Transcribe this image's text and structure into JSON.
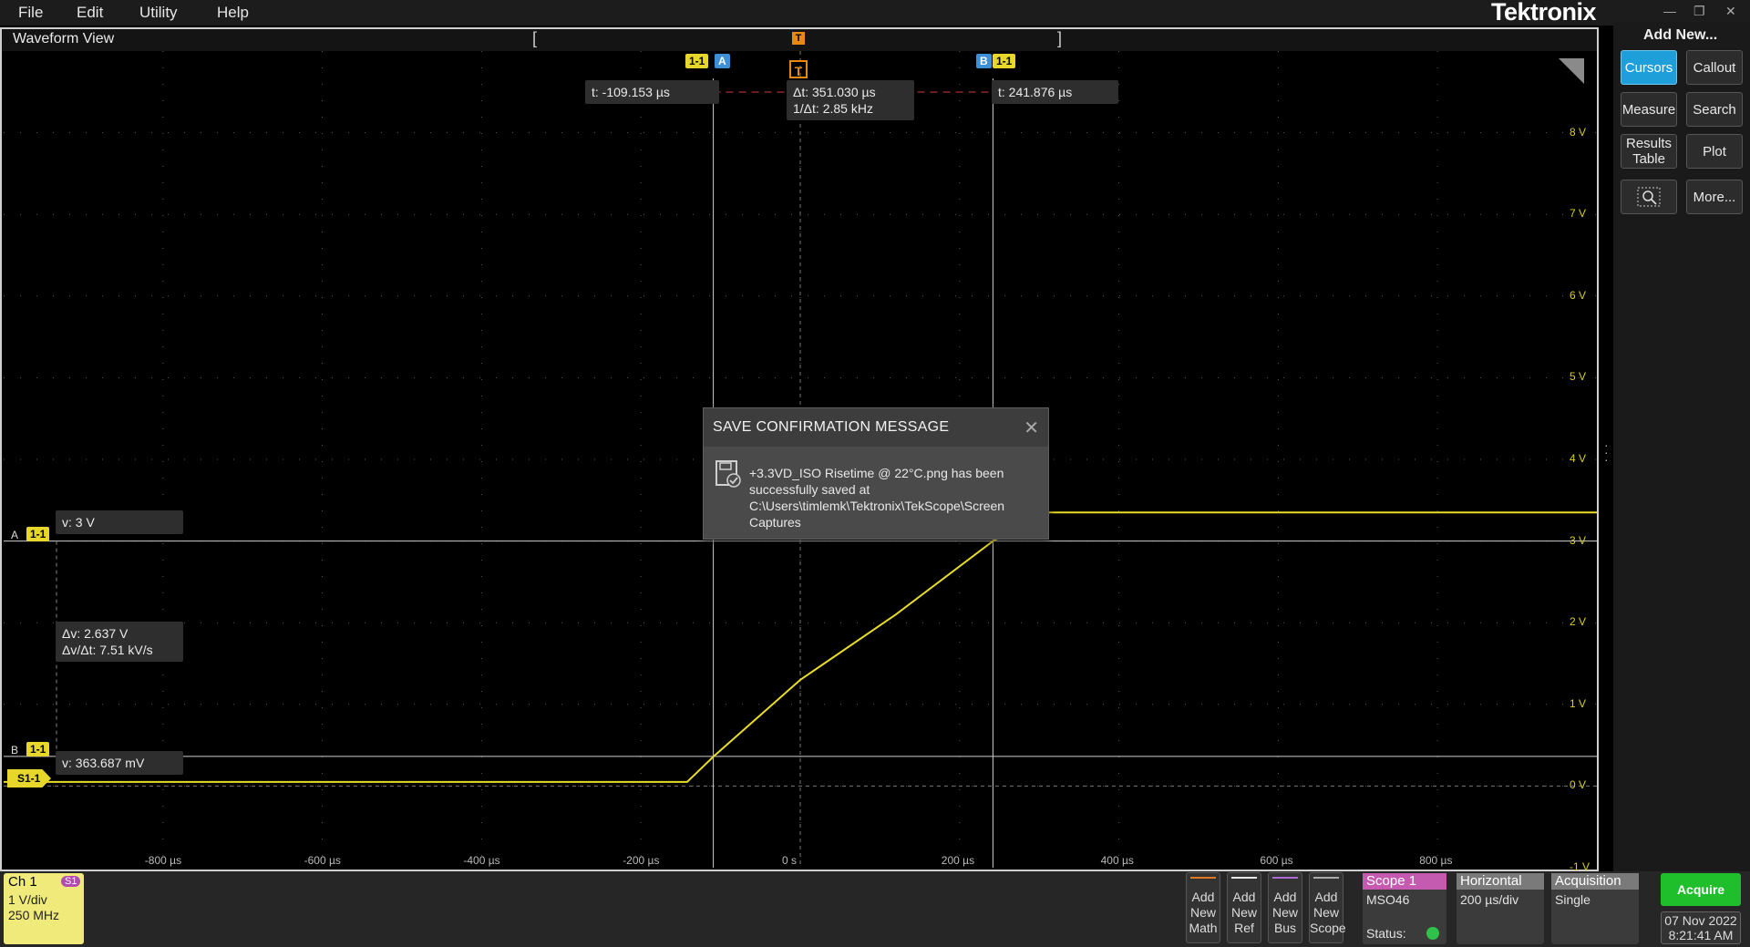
{
  "menu": {
    "items": [
      "File",
      "Edit",
      "Utility",
      "Help"
    ],
    "brand": "Tektronix"
  },
  "waveform_view": {
    "title": "Waveform View",
    "cursor_a": {
      "chip": "1-1",
      "tag": "A",
      "time_readout": "t: -109.153 µs"
    },
    "cursor_b": {
      "chip": "1-1",
      "tag": "B",
      "time_readout": "t: 241.876 µs"
    },
    "delta_readout": {
      "line1": "Δt: 351.030 µs",
      "line2": "1/Δt: 2.85 kHz"
    },
    "trigger_label": "T",
    "hcursor_a": {
      "tag": "A",
      "chip": "1-1",
      "readout": "v: 3 V"
    },
    "hcursor_b": {
      "tag": "B",
      "chip": "1-1",
      "readout": "v: 363.687 mV"
    },
    "dv_readout": {
      "line1": "Δv: 2.637 V",
      "line2": "Δv/Δt: 7.51 kV/s"
    },
    "channel_marker": "S1-1",
    "y_ticks": [
      "8 V",
      "7 V",
      "6 V",
      "5 V",
      "4 V",
      "3 V",
      "2 V",
      "1 V",
      "0 V",
      "-1 V"
    ],
    "x_ticks": [
      "-800 µs",
      "-600 µs",
      "-400 µs",
      "-200 µs",
      "0 s",
      "200 µs",
      "400 µs",
      "600 µs",
      "800 µs"
    ]
  },
  "dialog": {
    "title": "SAVE CONFIRMATION MESSAGE",
    "close": "✕",
    "message": "+3.3VD_ISO Risetime @ 22°C.png has been successfully saved at C:\\Users\\timlemk\\Tektronix\\TekScope\\Screen Captures"
  },
  "right_panel": {
    "title": "Add New...",
    "buttons": [
      "Cursors",
      "Callout",
      "Measure",
      "Search",
      "Results Table",
      "Plot",
      "More..."
    ],
    "active": "Cursors"
  },
  "bottom": {
    "channel": {
      "name": "Ch 1",
      "badge": "S1",
      "scale": "1 V/div",
      "bandwidth": "250 MHz"
    },
    "add_buttons": [
      {
        "label": "Add New Math",
        "color": "#e07a20"
      },
      {
        "label": "Add New Ref",
        "color": "#e8e8e8"
      },
      {
        "label": "Add New Bus",
        "color": "#b06ad8"
      },
      {
        "label": "Add New Scope",
        "color": "#aaaaaa"
      }
    ],
    "scope": {
      "title": "Scope 1",
      "model": "MSO46",
      "status_label": "Status:"
    },
    "horizontal": {
      "title": "Horizontal",
      "value": "200 µs/div"
    },
    "acquisition": {
      "title": "Acquisition",
      "value": "Single"
    },
    "acquire_button": "Acquire",
    "date": "07 Nov 2022",
    "time": "8:21:41 AM"
  },
  "chart_data": {
    "type": "line",
    "x_range": [
      -1000,
      1000
    ],
    "y_range": [
      -1,
      9
    ],
    "series": [
      {
        "points": [
          [
            -1000,
            0.05
          ],
          [
            -142,
            0.05
          ],
          [
            -109,
            0.36
          ],
          [
            0,
            1.3
          ],
          [
            120,
            2.1
          ],
          [
            242,
            3.0
          ],
          [
            310,
            3.35
          ],
          [
            1000,
            3.35
          ]
        ]
      }
    ],
    "cursors_v": [
      -109.153,
      241.876
    ],
    "cursors_h": [
      3.0,
      0.363687
    ],
    "colors": {
      "trace": "#e8dc2a",
      "grid": "#5a5a5a",
      "cursor": "#cfcfcf"
    }
  }
}
